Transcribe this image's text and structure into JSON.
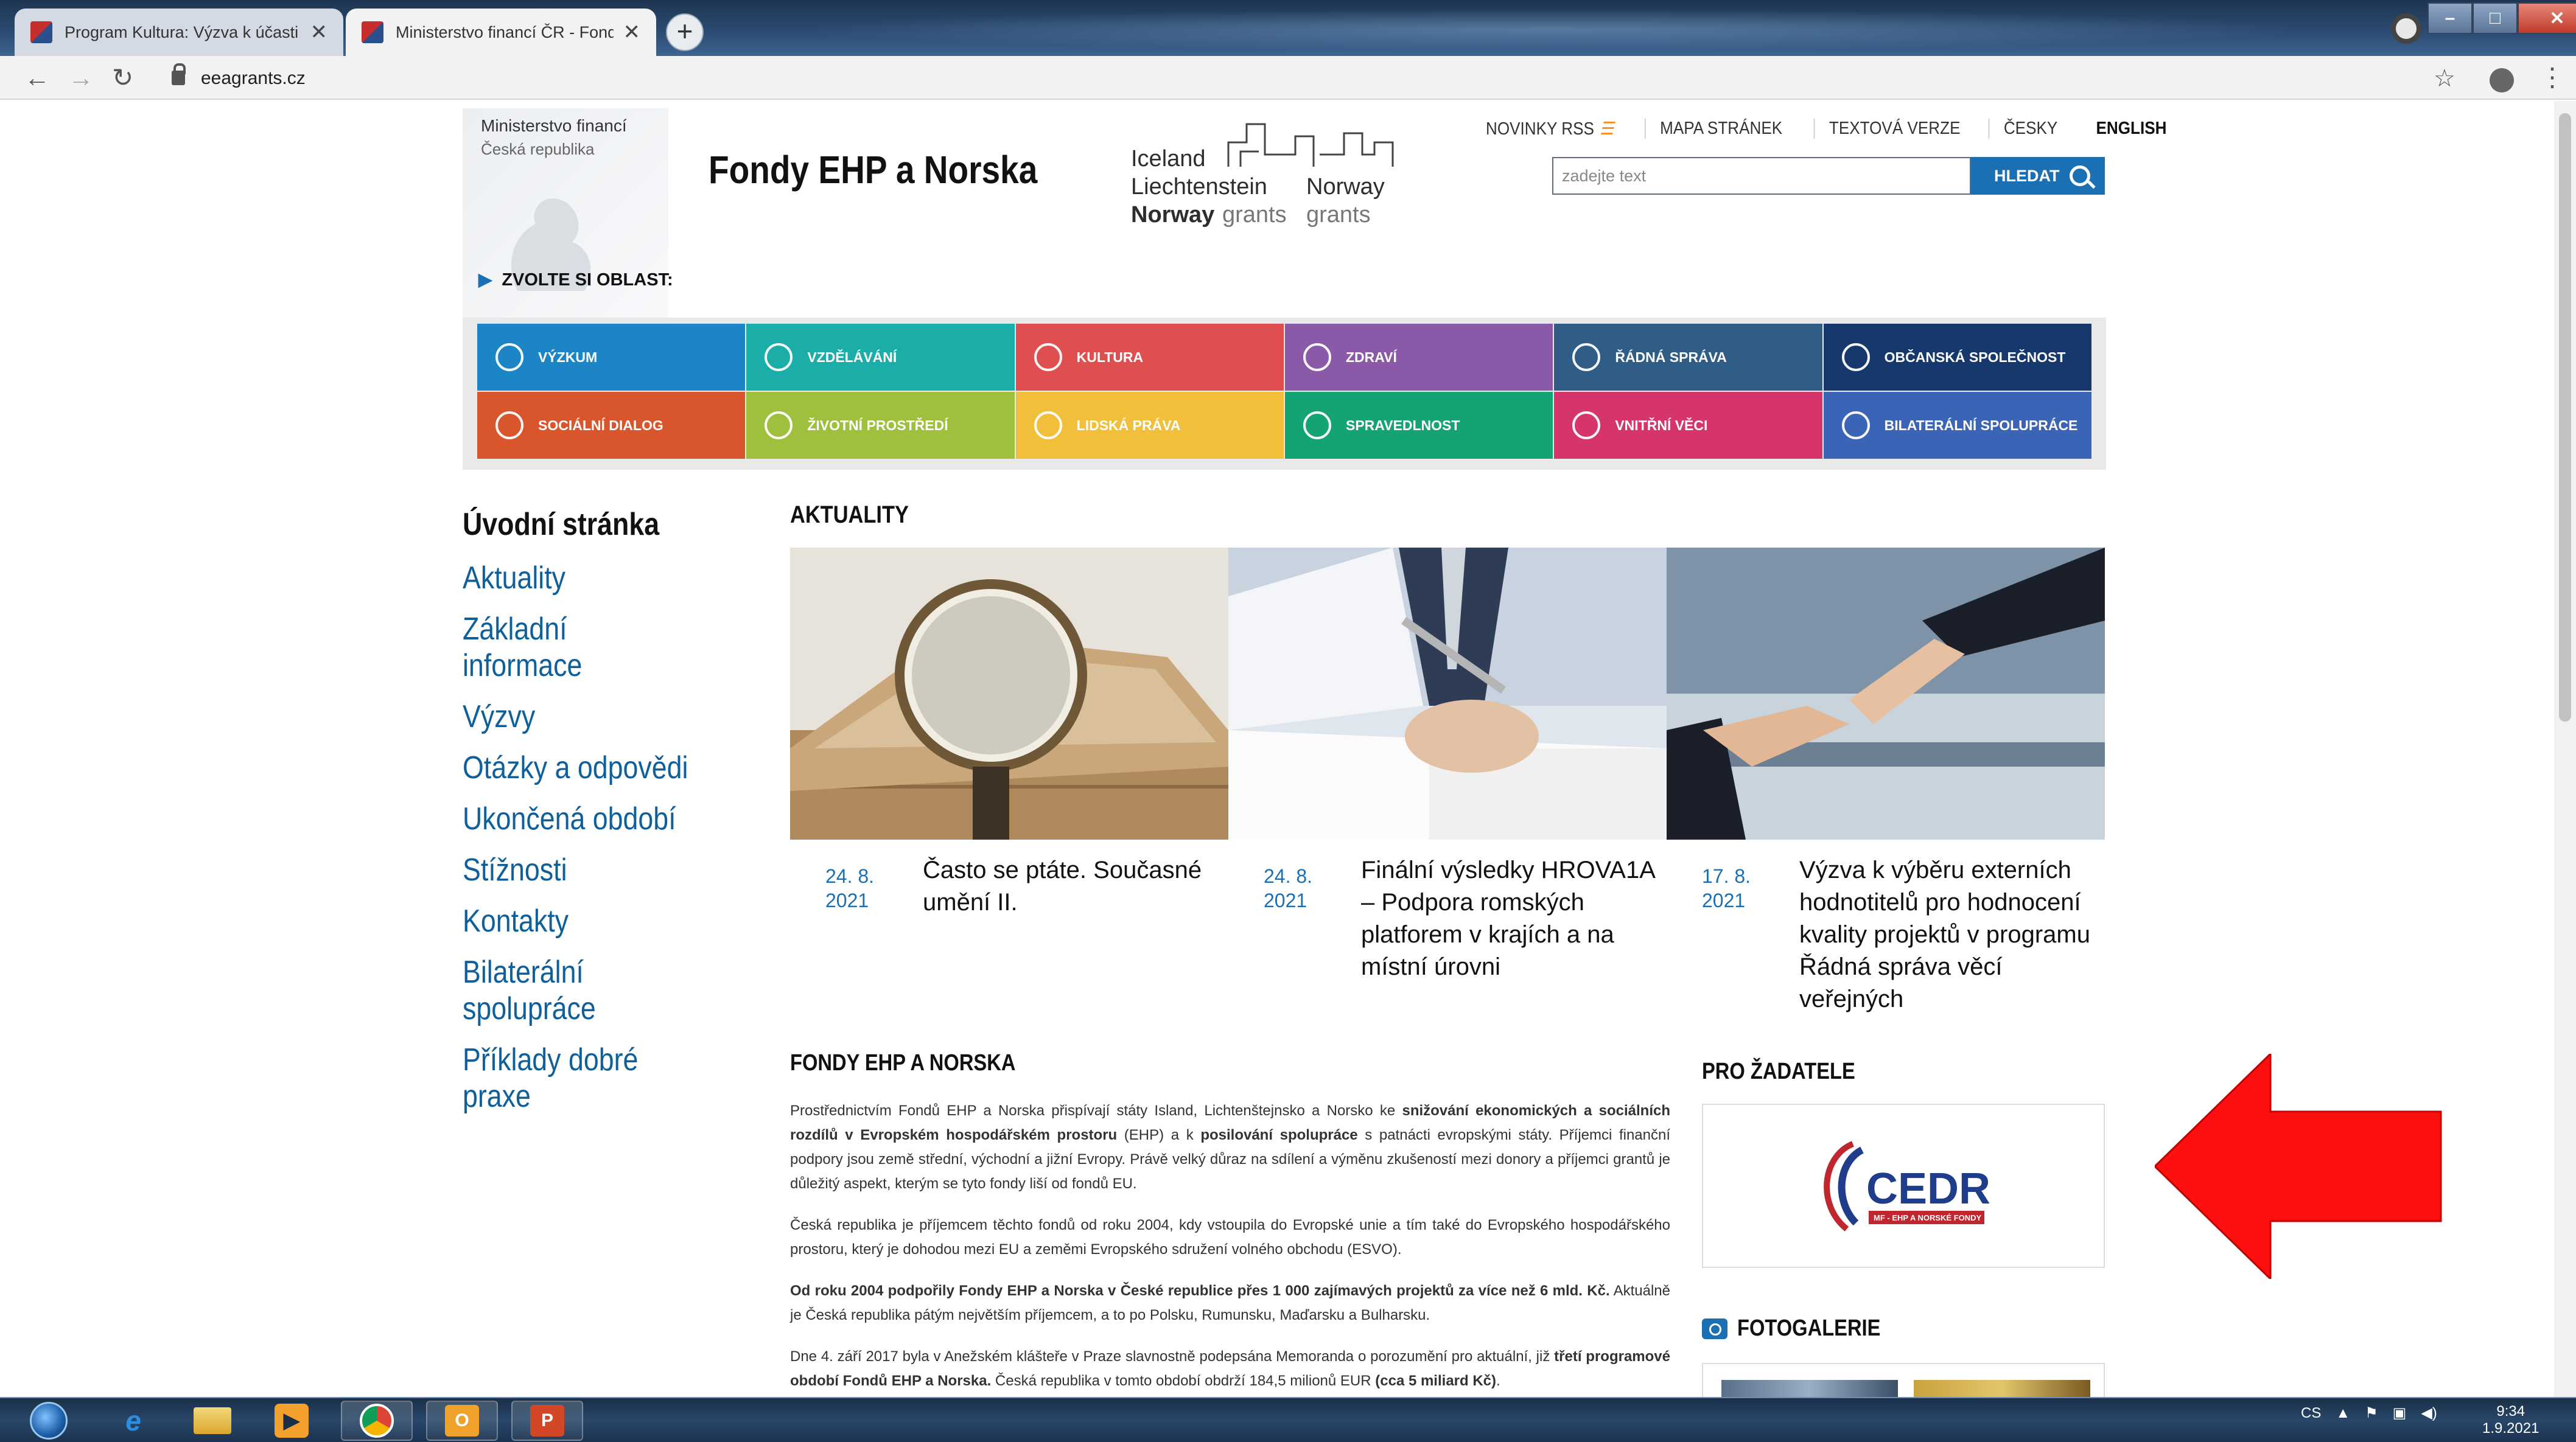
{
  "browser": {
    "tabs": [
      {
        "title": "Program Kultura: Výzva k účasti v"
      },
      {
        "title": "Ministerstvo financí ČR - Fondy E"
      }
    ],
    "new_tab_label": "+",
    "url": "eeagrants.cz"
  },
  "header": {
    "ministry_line1": "Ministerstvo financí",
    "ministry_line2": "Česká republika",
    "site_title": "Fondy EHP a Norska",
    "logo": {
      "iceland": "Iceland",
      "liechtenstein": "Liechtenstein",
      "norway": "Norway",
      "norway2": "Norway",
      "grants1": "grants",
      "grants2": "grants"
    },
    "links": {
      "rss": "NOVINKY RSS",
      "sitemap": "MAPA STRÁNEK",
      "text_version": "TEXTOVÁ VERZE",
      "czech": "ČESKY",
      "english": "ENGLISH"
    },
    "search_placeholder": "zadejte text",
    "search_button": "HLEDAT"
  },
  "areas": {
    "label": "ZVOLTE SI OBLAST:",
    "tiles": [
      {
        "label": "VÝZKUM",
        "color": "#1b85c6"
      },
      {
        "label": "VZDĚLÁVÁNÍ",
        "color": "#1bada8"
      },
      {
        "label": "KULTURA",
        "color": "#e04f4f"
      },
      {
        "label": "ZDRAVÍ",
        "color": "#8a5aa8"
      },
      {
        "label": "ŘÁDNÁ SPRÁVA",
        "color": "#2f5d86"
      },
      {
        "label": "OBČANSKÁ SPOLEČNOST",
        "color": "#16386c"
      },
      {
        "label": "SOCIÁLNÍ DIALOG",
        "color": "#d9552b"
      },
      {
        "label": "ŽIVOTNÍ PROSTŘEDÍ",
        "color": "#9ec03c"
      },
      {
        "label": "LIDSKÁ PRÁVA",
        "color": "#f2bf3a"
      },
      {
        "label": "SPRAVEDLNOST",
        "color": "#16a373"
      },
      {
        "label": "VNITŘNÍ VĚCI",
        "color": "#d6356b"
      },
      {
        "label": "BILATERÁLNÍ SPOLUPRÁCE",
        "color": "#3b63b6"
      }
    ]
  },
  "leftnav": {
    "home": "Úvodní stránka",
    "items": [
      "Aktuality",
      "Základní informace",
      "Výzvy",
      "Otázky a odpovědi",
      "Ukončená období",
      "Stížnosti",
      "Kontakty",
      "Bilaterální spolupráce",
      "Příklady dobré praxe"
    ]
  },
  "news": {
    "heading": "AKTUALITY",
    "items": [
      {
        "date": "24. 8. 2021",
        "title": "Často se ptáte. Současné umění II."
      },
      {
        "date": "24. 8. 2021",
        "title": "Finální výsledky HROVA1A – Podpora romských platforem v krajích a na místní úrovni"
      },
      {
        "date": "17. 8. 2021",
        "title": "Výzva k výběru externích hodnotitelů pro hodnocení kvality projektů v programu Řádná správa věcí veřejných"
      }
    ]
  },
  "fondy": {
    "heading": "FONDY EHP A NORSKA",
    "p1_a": "Prostřednictvím Fondů EHP a Norska přispívají státy Island, Lichtenštejnsko a Norsko ke ",
    "p1_b": "snižování ekonomických a sociálních rozdílů v Evropském hospodářském prostoru",
    "p1_c": " (EHP) a k ",
    "p1_d": "posilování spolupráce",
    "p1_e": " s patnácti evropskými státy. Příjemci finanční podpory jsou země střední, východní a jižní Evropy. Právě velký důraz na sdílení a výměnu zkušeností mezi donory a příjemci grantů je důležitý aspekt, kterým se tyto fondy liší od fondů EU.",
    "p2": "Česká republika je příjemcem těchto fondů od roku 2004, kdy vstoupila do Evropské unie a tím také do Evropského hospodářského prostoru, který je dohodou mezi EU a zeměmi Evropského sdružení volného obchodu (ESVO).",
    "p3_a": "Od roku 2004 podpořily Fondy EHP a Norska v České republice přes 1 000 zajímavých projektů za více než 6 mld. Kč.",
    "p3_b": " Aktuálně je Česká republika pátým největším příjemcem, a to po Polsku, Rumunsku, Maďarsku a Bulharsku.",
    "p4_a": "Dne 4. září 2017 byla v Anežském klášteře v Praze slavnostně podepsána Memoranda o porozumění pro aktuální, již ",
    "p4_b": "třetí programové období Fondů EHP a Norska.",
    "p4_c": " Česká republika v tomto období obdrží 184,5 milionů EUR ",
    "p4_d": "(cca 5 miliard Kč)",
    "p4_e": "."
  },
  "sidebar": {
    "pro_heading": "PRO ŽADATELE",
    "cedr_logo": "CEDR",
    "cedr_sub": "MF - EHP A NORSKÉ FONDY",
    "foto_heading": "FOTOGALERIE"
  },
  "taskbar": {
    "lang": "CS",
    "time": "9:34",
    "date": "1.9.2021"
  }
}
